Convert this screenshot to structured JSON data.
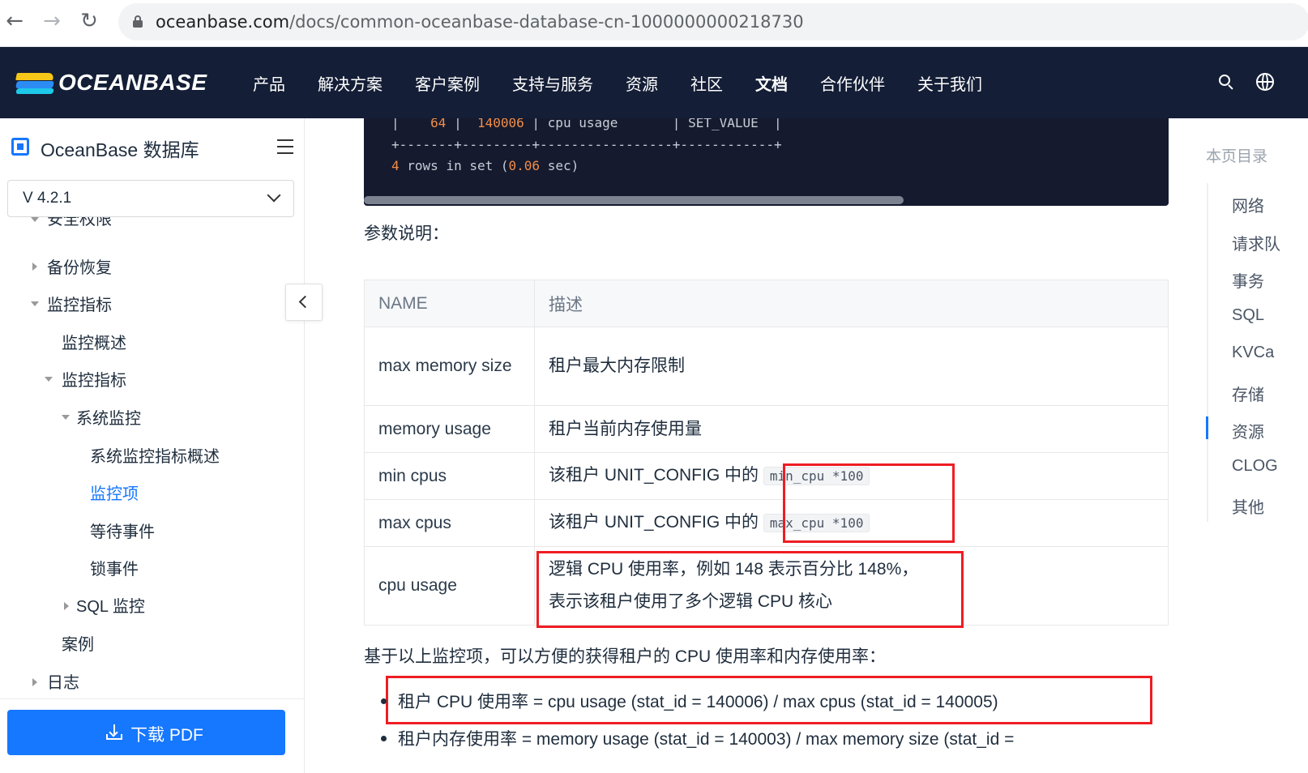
{
  "browser": {
    "url_domain": "oceanbase.com",
    "url_path": "/docs/common-oceanbase-database-cn-1000000000218730",
    "back_glyph": "←",
    "forward_glyph": "→",
    "reload_glyph": "↻"
  },
  "header": {
    "logo_text": "OCEANBASE",
    "nav": [
      "产品",
      "解决方案",
      "客户案例",
      "支持与服务",
      "资源",
      "社区",
      "文档",
      "合作伙伴",
      "关于我们"
    ],
    "active_nav": "文档"
  },
  "sidebar": {
    "title": "OceanBase 数据库",
    "version": "V 4.2.1",
    "items": [
      {
        "label": "安全权限"
      },
      {
        "label": "备份恢复"
      },
      {
        "label": "监控指标"
      },
      {
        "label": "监控概述"
      },
      {
        "label": "监控指标"
      },
      {
        "label": "系统监控"
      },
      {
        "label": "系统监控指标概述"
      },
      {
        "label": "监控项"
      },
      {
        "label": "等待事件"
      },
      {
        "label": "锁事件"
      },
      {
        "label": "SQL 监控"
      },
      {
        "label": "案例"
      },
      {
        "label": "日志"
      }
    ],
    "download_label": "下载 PDF"
  },
  "content": {
    "code_lines": {
      "row_id": "64",
      "stat_id": "140006",
      "name": "cpu usage",
      "class": "SET_VALUE",
      "separator": "+-------+---------+-----------------+------------+",
      "result_count": "4",
      "result_mid": "rows in set",
      "result_time": "0.06",
      "result_unit": "sec)"
    },
    "param_heading": "参数说明：",
    "table": {
      "headers": [
        "NAME",
        "描述"
      ],
      "rows": [
        {
          "name": "max memory size",
          "desc": "租户最大内存限制",
          "code": ""
        },
        {
          "name": "memory usage",
          "desc": "租户当前内存使用量",
          "code": ""
        },
        {
          "name": "min cpus",
          "desc": "该租户 UNIT_CONFIG 中的",
          "code": "min_cpu *100"
        },
        {
          "name": "max cpus",
          "desc": "该租户 UNIT_CONFIG 中的",
          "code": "max_cpu *100"
        },
        {
          "name": "cpu usage",
          "desc": "逻辑 CPU 使用率，例如 148 表示百分比 148%，",
          "desc2": "表示该租户使用了多个逻辑 CPU 核心",
          "code": ""
        }
      ]
    },
    "summary": "基于以上监控项，可以方便的获得租户的 CPU 使用率和内存使用率：",
    "formulas": [
      "租户 CPU 使用率 = cpu usage (stat_id = 140006) / max cpus (stat_id = 140005)",
      "租户内存使用率 = memory usage (stat_id = 140003) / max memory size (stat_id ="
    ]
  },
  "toc": {
    "title": "本页目录",
    "items": [
      "网络",
      "请求队",
      "事务",
      "SQL",
      "KVCa",
      "存储",
      "资源",
      "CLOG",
      "其他"
    ],
    "active": "资源"
  },
  "colors": {
    "header_bg": "#141e36",
    "accent": "#1677ff",
    "highlight": "#ee1d23",
    "code_bg": "#151a2e"
  }
}
